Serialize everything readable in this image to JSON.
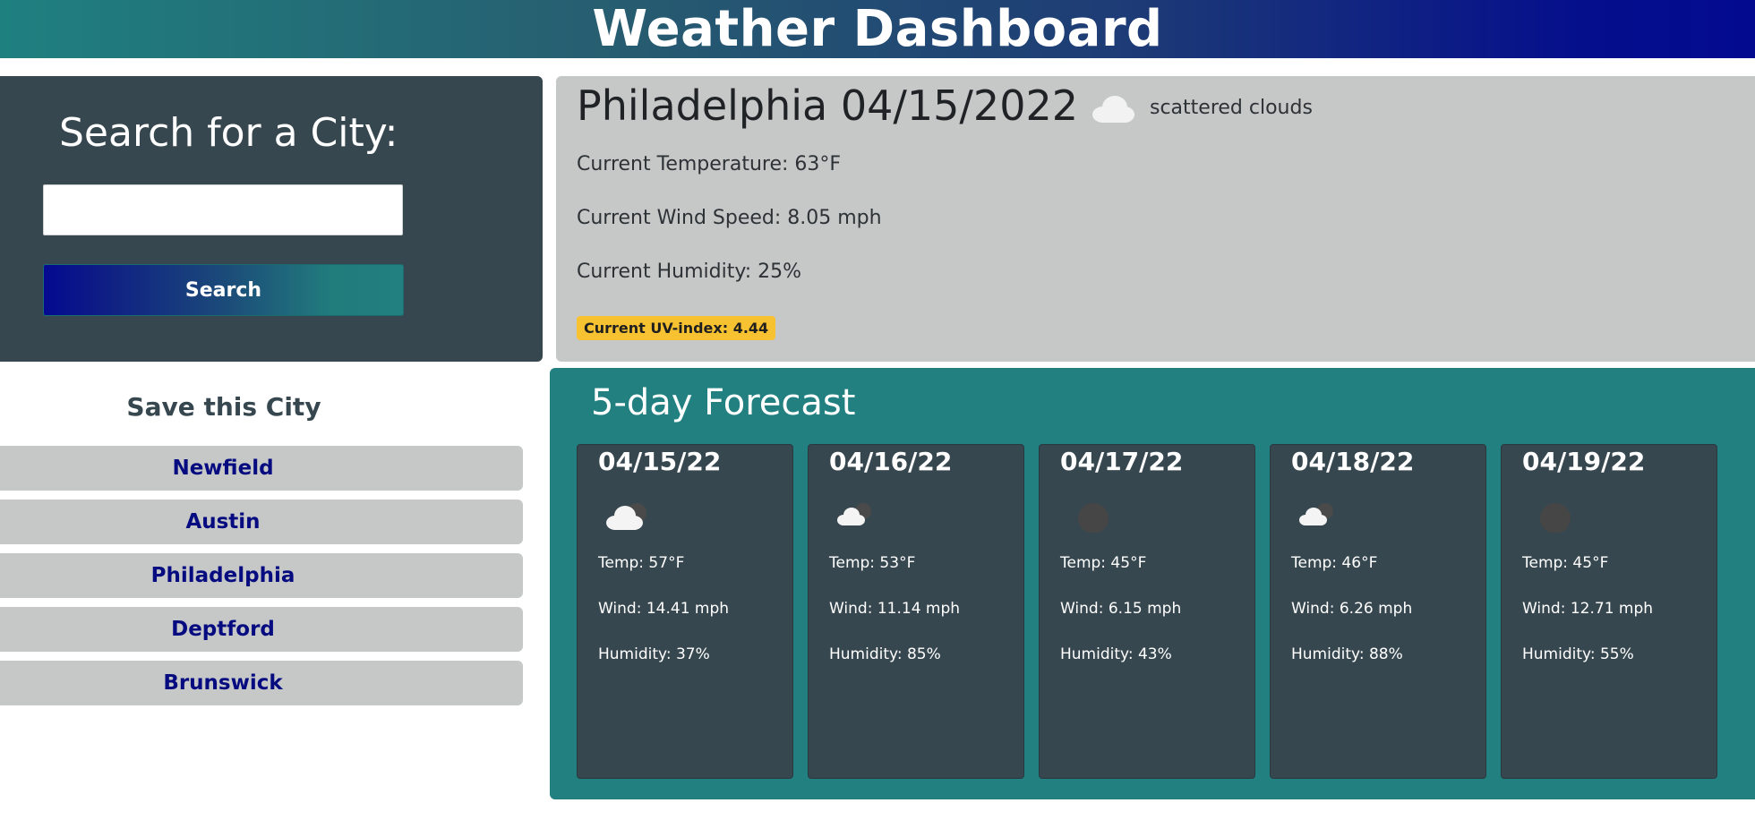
{
  "header": {
    "title": "Weather Dashboard"
  },
  "search": {
    "title": "Search for a City:",
    "input_value": "",
    "placeholder": "",
    "button_label": "Search"
  },
  "saved": {
    "title": "Save this City",
    "cities": [
      "Newfield",
      "Austin",
      "Philadelphia",
      "Deptford",
      "Brunswick"
    ]
  },
  "current": {
    "heading": "Philadelphia 04/15/2022",
    "icon": "cloud-icon",
    "description": "scattered clouds",
    "temperature": "Current Temperature: 63°F",
    "wind": "Current Wind Speed: 8.05 mph",
    "humidity": "Current Humidity: 25%",
    "uv": "Current UV-index: 4.44",
    "uv_color": "#f7c232"
  },
  "forecast": {
    "title": "5-day Forecast",
    "days": [
      {
        "date": "04/15/22",
        "icon": "broken-clouds-icon",
        "temp": "Temp: 57°F",
        "wind": "Wind: 14.41 mph",
        "humidity": "Humidity: 37%"
      },
      {
        "date": "04/16/22",
        "icon": "partly-cloudy-night-icon",
        "temp": "Temp: 53°F",
        "wind": "Wind: 11.14 mph",
        "humidity": "Humidity: 85%"
      },
      {
        "date": "04/17/22",
        "icon": "clear-night-icon",
        "temp": "Temp: 45°F",
        "wind": "Wind: 6.15 mph",
        "humidity": "Humidity: 43%"
      },
      {
        "date": "04/18/22",
        "icon": "partly-cloudy-night-icon",
        "temp": "Temp: 46°F",
        "wind": "Wind: 6.26 mph",
        "humidity": "Humidity: 88%"
      },
      {
        "date": "04/19/22",
        "icon": "clear-night-icon",
        "temp": "Temp: 45°F",
        "wind": "Wind: 12.71 mph",
        "humidity": "Humidity: 55%"
      }
    ]
  },
  "colors": {
    "header_gradient_start": "#1f8080",
    "header_gradient_end": "#030a90",
    "panel_dark": "#37474f",
    "panel_light": "#c6c8c8",
    "forecast_bg": "#228080",
    "city_text": "#060b80"
  }
}
